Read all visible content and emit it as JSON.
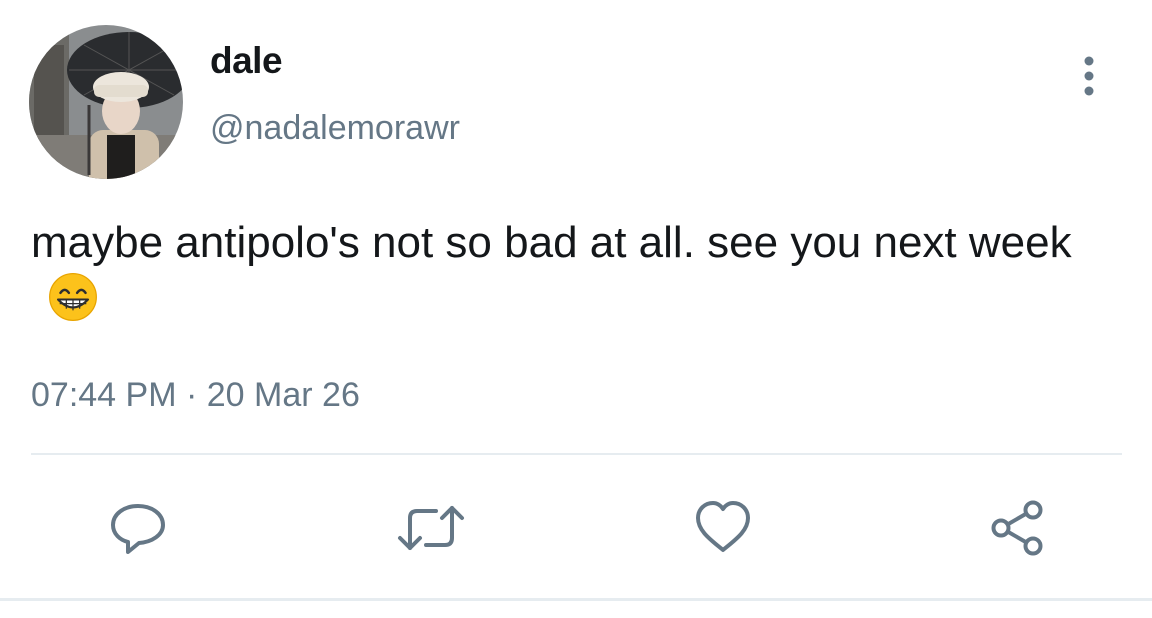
{
  "tweet": {
    "author": {
      "display_name": "dale",
      "handle": "@nadalemorawr",
      "avatar_icon": "profile-photo"
    },
    "text": "maybe antipolo's not so bad at all. see you next week",
    "emoji": "grinning-face-with-smiling-eyes",
    "time": "07:44 PM",
    "separator": "·",
    "date": "20 Mar 26"
  },
  "actions": [
    {
      "name": "reply",
      "icon": "speech-bubble-icon"
    },
    {
      "name": "retweet",
      "icon": "retweet-icon"
    },
    {
      "name": "like",
      "icon": "heart-icon"
    },
    {
      "name": "share",
      "icon": "share-icon"
    }
  ],
  "colors": {
    "text_primary": "#14171a",
    "text_secondary": "#657786",
    "icon": "#657786",
    "divider": "#e6ecf0",
    "background": "#ffffff"
  }
}
